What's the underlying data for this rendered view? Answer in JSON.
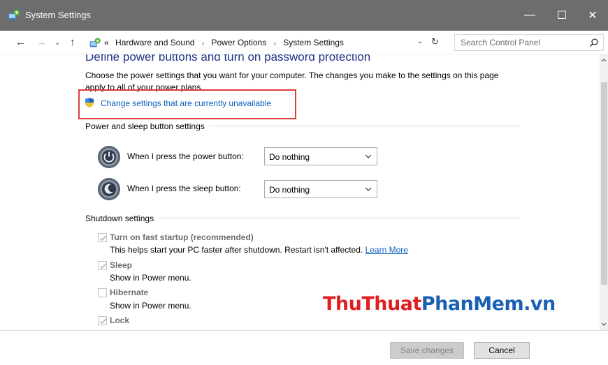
{
  "window": {
    "title": "System Settings",
    "controls": {
      "minimize": "—",
      "maximize": "☐",
      "close": "✕"
    }
  },
  "navigation": {
    "back": "←",
    "forward": "→",
    "recent": "⌄",
    "up": "↑",
    "breadcrumb_prefix": "«",
    "breadcrumbs": [
      "Hardware and Sound",
      "Power Options",
      "System Settings"
    ],
    "separator": "›",
    "dropdown": "⌄",
    "refresh": "↻",
    "search_placeholder": "Search Control Panel"
  },
  "main": {
    "heading": "Define power buttons and turn on password protection",
    "intro": "Choose the power settings that you want for your computer. The changes you make to the settings on this page apply to all of your power plans.",
    "change_link": "Change settings that are currently unavailable",
    "power_group": {
      "title": "Power and sleep button settings",
      "rows": [
        {
          "label": "When I press the power button:",
          "value": "Do nothing"
        },
        {
          "label": "When I press the sleep button:",
          "value": "Do nothing"
        }
      ]
    },
    "shutdown_group": {
      "title": "Shutdown settings",
      "options": [
        {
          "label": "Turn on fast startup (recommended)",
          "checked": true,
          "desc": "This helps start your PC faster after shutdown. Restart isn't affected.",
          "link": "Learn More"
        },
        {
          "label": "Sleep",
          "checked": true,
          "desc": "Show in Power menu."
        },
        {
          "label": "Hibernate",
          "checked": false,
          "desc": "Show in Power menu."
        },
        {
          "label": "Lock",
          "checked": true
        }
      ]
    }
  },
  "watermark": {
    "part1": "ThuThuat",
    "part2": "PhanMem",
    "part3": ".vn",
    "color_red": "#e02020",
    "color_blue": "#1a5fb4"
  },
  "footer": {
    "save_label": "Save changes",
    "cancel_label": "Cancel"
  },
  "colors": {
    "title_bar": "#6d6d6d",
    "heading": "#1e3287",
    "link": "#0a5fbc",
    "highlight_box": "#e03c3c"
  }
}
